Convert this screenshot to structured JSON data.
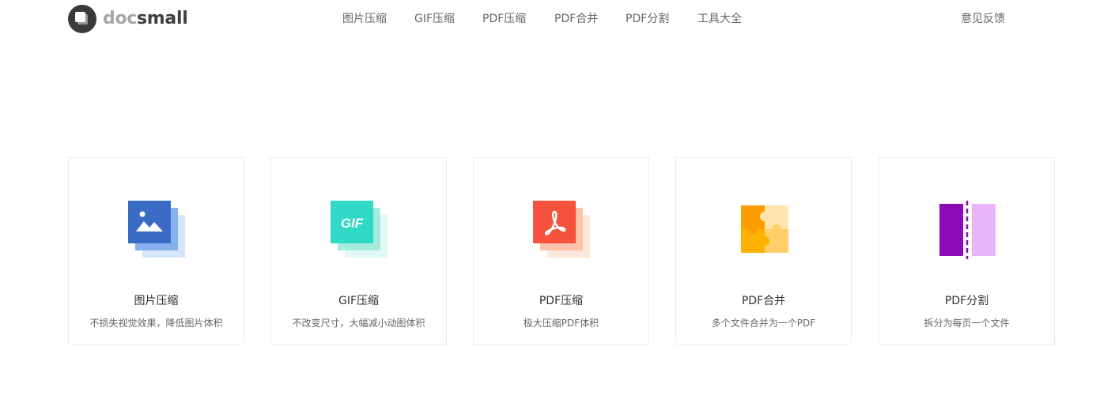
{
  "header": {
    "logo": {
      "part1": "doc",
      "part2": "small"
    },
    "nav": [
      {
        "label": "图片压缩"
      },
      {
        "label": "GIF压缩"
      },
      {
        "label": "PDF压缩"
      },
      {
        "label": "PDF合并"
      },
      {
        "label": "PDF分割"
      },
      {
        "label": "工具大全"
      }
    ],
    "feedback": "意见反馈"
  },
  "cards": [
    {
      "title": "图片压缩",
      "desc": "不损失视觉效果，降低图片体积",
      "icon": "image-compress-icon",
      "color": "#3a6bc4"
    },
    {
      "title": "GIF压缩",
      "desc": "不改变尺寸，大幅减小动图体积",
      "icon": "gif-compress-icon",
      "icon_text": "GIF",
      "color": "#2fd9c6"
    },
    {
      "title": "PDF压缩",
      "desc": "极大压缩PDF体积",
      "icon": "pdf-compress-icon",
      "color": "#f5533d"
    },
    {
      "title": "PDF合并",
      "desc": "多个文件合并为一个PDF",
      "icon": "puzzle-merge-icon",
      "color": "#ffa81c"
    },
    {
      "title": "PDF分割",
      "desc": "拆分为每页一个文件",
      "icon": "split-icon",
      "color": "#8a0ab8"
    }
  ]
}
